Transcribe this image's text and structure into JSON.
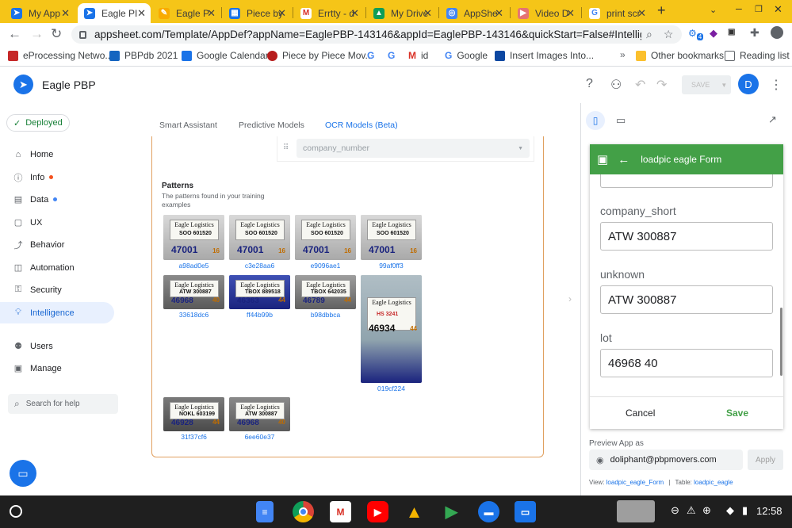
{
  "browser": {
    "tabs": [
      {
        "label": "My App",
        "icon": "appsheet-icon",
        "active": false
      },
      {
        "label": "Eagle PI",
        "icon": "appsheet-icon",
        "active": true
      },
      {
        "label": "Eagle P",
        "icon": "doc-icon",
        "active": false
      },
      {
        "label": "Piece by",
        "icon": "calendar-icon",
        "active": false
      },
      {
        "label": "Errtty - d",
        "icon": "gmail-icon",
        "active": false
      },
      {
        "label": "My Drive",
        "icon": "drive-icon",
        "active": false
      },
      {
        "label": "AppShe",
        "icon": "appsheet-icon",
        "active": false
      },
      {
        "label": "Video D",
        "icon": "video-icon",
        "active": false
      },
      {
        "label": "print scr",
        "icon": "google-icon",
        "active": false
      }
    ],
    "url": "appsheet.com/Template/AppDef?appName=EaglePBP-143146&appId=EaglePBP-143146&quickStart=False#Intelligence.OcrMod...",
    "ext_badge": "4",
    "bookmarks": [
      {
        "label": "eProcessing Netwo...",
        "color": "#c62828"
      },
      {
        "label": "PBPdb 2021",
        "color": "#1565c0"
      },
      {
        "label": "Google Calendar",
        "color": "#1a73e8"
      },
      {
        "label": "Piece by Piece Mov...",
        "color": "#b71c1c"
      },
      {
        "label": "",
        "color": "#4285f4"
      },
      {
        "label": "",
        "color": "#4285f4"
      },
      {
        "label": "id",
        "color": "#d93025"
      },
      {
        "label": "Google",
        "color": "#4285f4"
      },
      {
        "label": "Insert Images Into...",
        "color": "#0d47a1"
      }
    ],
    "other_bookmarks": "Other bookmarks",
    "reading_list": "Reading list"
  },
  "app": {
    "name": "Eagle PBP",
    "save_label": "SAVE",
    "avatar_letter": "D"
  },
  "sidebar": {
    "deployed": "Deployed",
    "items": [
      {
        "label": "Home",
        "icon": "home-icon",
        "dot": ""
      },
      {
        "label": "Info",
        "icon": "info-icon",
        "dot": "#f4511e"
      },
      {
        "label": "Data",
        "icon": "data-icon",
        "dot": "#4285f4"
      },
      {
        "label": "UX",
        "icon": "ux-icon",
        "dot": ""
      },
      {
        "label": "Behavior",
        "icon": "behavior-icon",
        "dot": ""
      },
      {
        "label": "Automation",
        "icon": "automation-icon",
        "dot": ""
      },
      {
        "label": "Security",
        "icon": "security-icon",
        "dot": ""
      },
      {
        "label": "Intelligence",
        "icon": "intelligence-icon",
        "dot": "",
        "active": true
      },
      {
        "label": "Users",
        "icon": "users-icon",
        "dot": ""
      },
      {
        "label": "Manage",
        "icon": "manage-icon",
        "dot": ""
      }
    ],
    "search_placeholder": "Search for help"
  },
  "main": {
    "tabs": [
      "Smart Assistant",
      "Predictive Models",
      "OCR Models (Beta)"
    ],
    "active_tab": "OCR Models (Beta)",
    "column_select": "company_number",
    "patterns_title": "Patterns",
    "patterns_desc": "The patterns found in your training examples",
    "patterns": [
      {
        "id": "a98ad0e5",
        "company": "Eagle Logistics",
        "code": "SOO 601520",
        "num": "47001",
        "lot": "16"
      },
      {
        "id": "c3e28aa6",
        "company": "Eagle Logistics",
        "code": "SOO 601520",
        "num": "47001",
        "lot": "16"
      },
      {
        "id": "e9096ae1",
        "company": "Eagle Logistics",
        "code": "SOO 601520",
        "num": "47001",
        "lot": "16"
      },
      {
        "id": "99af0ff3",
        "company": "Eagle Logistics",
        "code": "SOO 601520",
        "num": "47001",
        "lot": "16"
      },
      {
        "id": "33618dc6",
        "company": "Eagle Logistics",
        "code": "ATW 300887",
        "num": "46968",
        "lot": "40"
      },
      {
        "id": "ff44b99b",
        "company": "Eagle Logistics",
        "code": "TBOX 889518",
        "num": "46363",
        "lot": "44"
      },
      {
        "id": "b98dbbca",
        "company": "Eagle Logistics",
        "code": "TBOX 642035",
        "num": "46789",
        "lot": "44"
      },
      {
        "id": "019cf224",
        "company": "Eagle Logistics",
        "code": "HS 3241",
        "num": "46934",
        "lot": "44"
      },
      {
        "id": "31f37cf6",
        "company": "Eagle Logistics",
        "code": "NOKL 603199",
        "num": "46928",
        "lot": "44"
      },
      {
        "id": "6ee60e37",
        "company": "Eagle Logistics",
        "code": "ATW 300887",
        "num": "46968",
        "lot": "40"
      }
    ]
  },
  "preview": {
    "form_title": "loadpic eagle Form",
    "fields": [
      {
        "label": "company_short",
        "value": "ATW 300887"
      },
      {
        "label": "unknown",
        "value": "ATW 300887"
      },
      {
        "label": "lot",
        "value": "46968 40"
      }
    ],
    "cancel": "Cancel",
    "save": "Save",
    "preview_as_label": "Preview App as",
    "email": "doliphant@pbpmovers.com",
    "apply": "Apply",
    "view_label": "View:",
    "view_value": "loadpic_eagle_Form",
    "table_label": "Table:",
    "table_value": "loadpic_eagle"
  },
  "taskbar": {
    "time": "12:58",
    "apps": [
      "docs-icon",
      "chrome-icon",
      "gmail-icon",
      "youtube-icon",
      "drive-icon",
      "play-icon",
      "messages-icon",
      "files-icon"
    ]
  }
}
